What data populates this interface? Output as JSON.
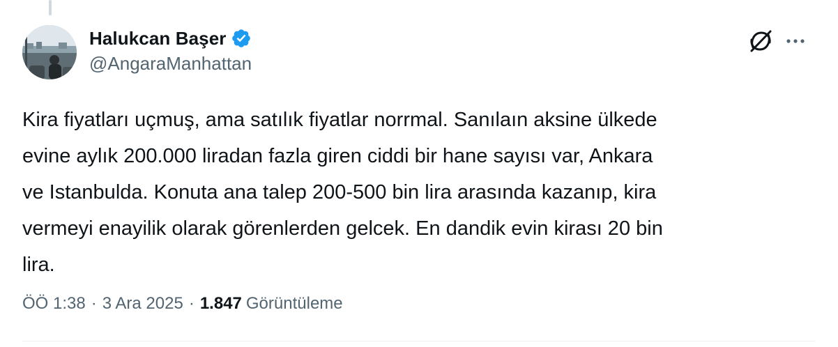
{
  "tweet": {
    "author": {
      "display_name": "Halukcan Başer",
      "handle": "@AngaraManhattan",
      "verified": true
    },
    "text": "Kira fiyatları uçmuş, ama satılık fiyatlar norrmal. Sanılaın aksine ülkede\nevine aylık 200.000 liradan fazla giren ciddi bir hane sayısı var, Ankara\nve Istanbulda. Konuta ana talep 200-500 bin lira arasında kazanıp, kira\nvermeyi enayilik olarak görenlerden gelcek. En dandik evin kirası 20 bin\nlira.",
    "time": "ÖÖ 1:38",
    "date": "3 Ara 2025",
    "separator": "·",
    "views_count": "1.847",
    "views_label": "Görüntüleme"
  },
  "icons": {
    "verified": "verified-badge-icon",
    "grok": "grok-icon",
    "more": "more-dots-icon"
  },
  "colors": {
    "text_primary": "#0f1419",
    "text_secondary": "#536471",
    "verified_blue": "#1d9bf0",
    "divider": "#eff3f4"
  }
}
